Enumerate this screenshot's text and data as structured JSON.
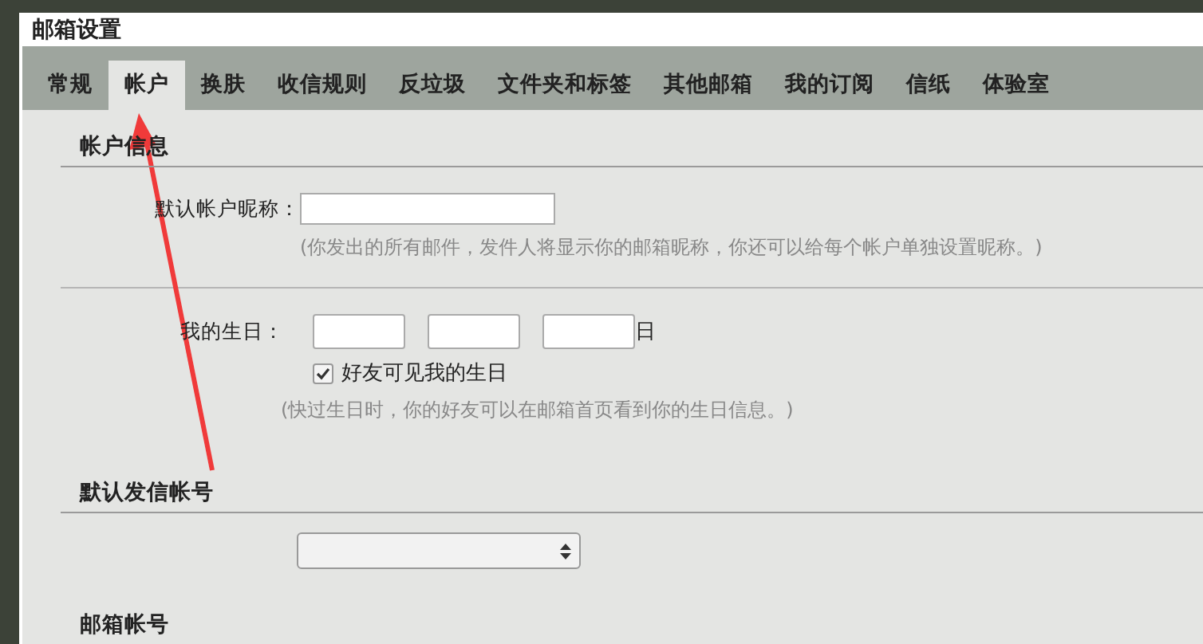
{
  "window": {
    "title": "邮箱设置"
  },
  "tabs": [
    {
      "label": "常规",
      "selected": false
    },
    {
      "label": "帐户",
      "selected": true
    },
    {
      "label": "换肤",
      "selected": false
    },
    {
      "label": "收信规则",
      "selected": false
    },
    {
      "label": "反垃圾",
      "selected": false
    },
    {
      "label": "文件夹和标签",
      "selected": false
    },
    {
      "label": "其他邮箱",
      "selected": false
    },
    {
      "label": "我的订阅",
      "selected": false
    },
    {
      "label": "信纸",
      "selected": false
    },
    {
      "label": "体验室",
      "selected": false
    }
  ],
  "account_info": {
    "heading": "帐户信息",
    "nickname_label": "默认帐户昵称：",
    "nickname_hint": "(你发出的所有邮件，发件人将显示你的邮箱昵称，你还可以给每个帐户单独设置昵称。)",
    "birthday_label": "我的生日：",
    "birthday_day_suffix": "日",
    "birthday_visible": {
      "label": "好友可见我的生日",
      "checked": true
    },
    "birthday_hint": "(快过生日时，你的好友可以在邮箱首页看到你的生日信息。)"
  },
  "default_sender": {
    "heading": "默认发信帐号"
  },
  "mail_accounts": {
    "heading": "邮箱帐号"
  }
}
